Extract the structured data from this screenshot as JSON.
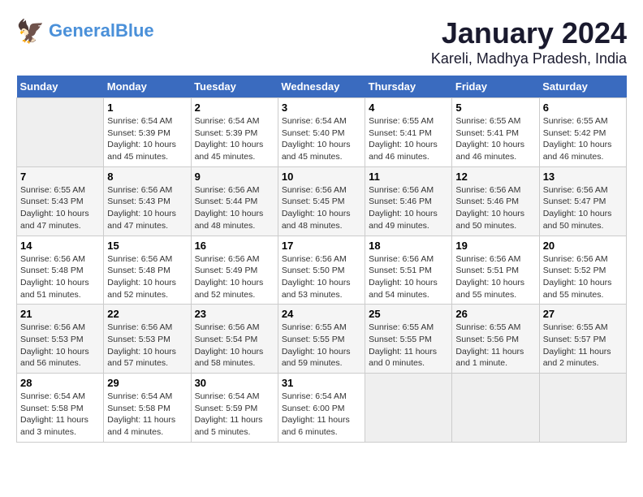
{
  "header": {
    "logo_general": "General",
    "logo_blue": "Blue",
    "month_title": "January 2024",
    "location": "Kareli, Madhya Pradesh, India"
  },
  "days": [
    "Sunday",
    "Monday",
    "Tuesday",
    "Wednesday",
    "Thursday",
    "Friday",
    "Saturday"
  ],
  "weeks": [
    [
      {
        "date": "",
        "empty": true
      },
      {
        "date": "1",
        "sunrise": "Sunrise: 6:54 AM",
        "sunset": "Sunset: 5:39 PM",
        "daylight": "Daylight: 10 hours and 45 minutes."
      },
      {
        "date": "2",
        "sunrise": "Sunrise: 6:54 AM",
        "sunset": "Sunset: 5:39 PM",
        "daylight": "Daylight: 10 hours and 45 minutes."
      },
      {
        "date": "3",
        "sunrise": "Sunrise: 6:54 AM",
        "sunset": "Sunset: 5:40 PM",
        "daylight": "Daylight: 10 hours and 45 minutes."
      },
      {
        "date": "4",
        "sunrise": "Sunrise: 6:55 AM",
        "sunset": "Sunset: 5:41 PM",
        "daylight": "Daylight: 10 hours and 46 minutes."
      },
      {
        "date": "5",
        "sunrise": "Sunrise: 6:55 AM",
        "sunset": "Sunset: 5:41 PM",
        "daylight": "Daylight: 10 hours and 46 minutes."
      },
      {
        "date": "6",
        "sunrise": "Sunrise: 6:55 AM",
        "sunset": "Sunset: 5:42 PM",
        "daylight": "Daylight: 10 hours and 46 minutes."
      }
    ],
    [
      {
        "date": "7",
        "sunrise": "Sunrise: 6:55 AM",
        "sunset": "Sunset: 5:43 PM",
        "daylight": "Daylight: 10 hours and 47 minutes."
      },
      {
        "date": "8",
        "sunrise": "Sunrise: 6:56 AM",
        "sunset": "Sunset: 5:43 PM",
        "daylight": "Daylight: 10 hours and 47 minutes."
      },
      {
        "date": "9",
        "sunrise": "Sunrise: 6:56 AM",
        "sunset": "Sunset: 5:44 PM",
        "daylight": "Daylight: 10 hours and 48 minutes."
      },
      {
        "date": "10",
        "sunrise": "Sunrise: 6:56 AM",
        "sunset": "Sunset: 5:45 PM",
        "daylight": "Daylight: 10 hours and 48 minutes."
      },
      {
        "date": "11",
        "sunrise": "Sunrise: 6:56 AM",
        "sunset": "Sunset: 5:46 PM",
        "daylight": "Daylight: 10 hours and 49 minutes."
      },
      {
        "date": "12",
        "sunrise": "Sunrise: 6:56 AM",
        "sunset": "Sunset: 5:46 PM",
        "daylight": "Daylight: 10 hours and 50 minutes."
      },
      {
        "date": "13",
        "sunrise": "Sunrise: 6:56 AM",
        "sunset": "Sunset: 5:47 PM",
        "daylight": "Daylight: 10 hours and 50 minutes."
      }
    ],
    [
      {
        "date": "14",
        "sunrise": "Sunrise: 6:56 AM",
        "sunset": "Sunset: 5:48 PM",
        "daylight": "Daylight: 10 hours and 51 minutes."
      },
      {
        "date": "15",
        "sunrise": "Sunrise: 6:56 AM",
        "sunset": "Sunset: 5:48 PM",
        "daylight": "Daylight: 10 hours and 52 minutes."
      },
      {
        "date": "16",
        "sunrise": "Sunrise: 6:56 AM",
        "sunset": "Sunset: 5:49 PM",
        "daylight": "Daylight: 10 hours and 52 minutes."
      },
      {
        "date": "17",
        "sunrise": "Sunrise: 6:56 AM",
        "sunset": "Sunset: 5:50 PM",
        "daylight": "Daylight: 10 hours and 53 minutes."
      },
      {
        "date": "18",
        "sunrise": "Sunrise: 6:56 AM",
        "sunset": "Sunset: 5:51 PM",
        "daylight": "Daylight: 10 hours and 54 minutes."
      },
      {
        "date": "19",
        "sunrise": "Sunrise: 6:56 AM",
        "sunset": "Sunset: 5:51 PM",
        "daylight": "Daylight: 10 hours and 55 minutes."
      },
      {
        "date": "20",
        "sunrise": "Sunrise: 6:56 AM",
        "sunset": "Sunset: 5:52 PM",
        "daylight": "Daylight: 10 hours and 55 minutes."
      }
    ],
    [
      {
        "date": "21",
        "sunrise": "Sunrise: 6:56 AM",
        "sunset": "Sunset: 5:53 PM",
        "daylight": "Daylight: 10 hours and 56 minutes."
      },
      {
        "date": "22",
        "sunrise": "Sunrise: 6:56 AM",
        "sunset": "Sunset: 5:53 PM",
        "daylight": "Daylight: 10 hours and 57 minutes."
      },
      {
        "date": "23",
        "sunrise": "Sunrise: 6:56 AM",
        "sunset": "Sunset: 5:54 PM",
        "daylight": "Daylight: 10 hours and 58 minutes."
      },
      {
        "date": "24",
        "sunrise": "Sunrise: 6:55 AM",
        "sunset": "Sunset: 5:55 PM",
        "daylight": "Daylight: 10 hours and 59 minutes."
      },
      {
        "date": "25",
        "sunrise": "Sunrise: 6:55 AM",
        "sunset": "Sunset: 5:55 PM",
        "daylight": "Daylight: 11 hours and 0 minutes."
      },
      {
        "date": "26",
        "sunrise": "Sunrise: 6:55 AM",
        "sunset": "Sunset: 5:56 PM",
        "daylight": "Daylight: 11 hours and 1 minute."
      },
      {
        "date": "27",
        "sunrise": "Sunrise: 6:55 AM",
        "sunset": "Sunset: 5:57 PM",
        "daylight": "Daylight: 11 hours and 2 minutes."
      }
    ],
    [
      {
        "date": "28",
        "sunrise": "Sunrise: 6:54 AM",
        "sunset": "Sunset: 5:58 PM",
        "daylight": "Daylight: 11 hours and 3 minutes."
      },
      {
        "date": "29",
        "sunrise": "Sunrise: 6:54 AM",
        "sunset": "Sunset: 5:58 PM",
        "daylight": "Daylight: 11 hours and 4 minutes."
      },
      {
        "date": "30",
        "sunrise": "Sunrise: 6:54 AM",
        "sunset": "Sunset: 5:59 PM",
        "daylight": "Daylight: 11 hours and 5 minutes."
      },
      {
        "date": "31",
        "sunrise": "Sunrise: 6:54 AM",
        "sunset": "Sunset: 6:00 PM",
        "daylight": "Daylight: 11 hours and 6 minutes."
      },
      {
        "date": "",
        "empty": true
      },
      {
        "date": "",
        "empty": true
      },
      {
        "date": "",
        "empty": true
      }
    ]
  ]
}
